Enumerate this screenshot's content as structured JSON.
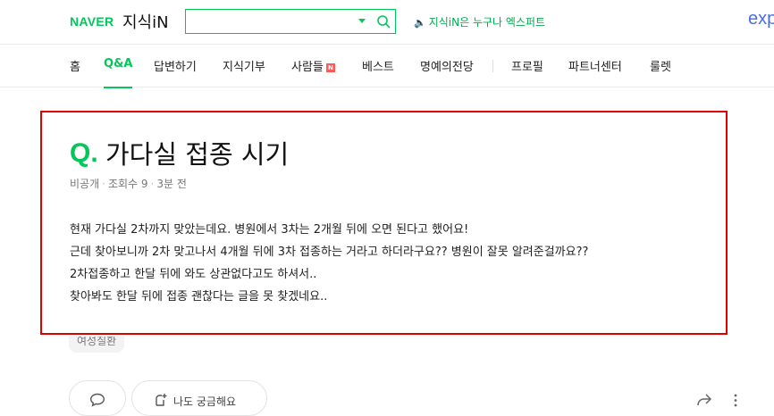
{
  "header": {
    "brand": "NAVER",
    "service": "지식iN",
    "search": {
      "value": "",
      "placeholder": ""
    },
    "notice": "지식iN은 누구나 엑스퍼트",
    "partial_logo": "exp"
  },
  "nav": {
    "items": [
      {
        "label": "홈"
      },
      {
        "label": "Q&A",
        "active": true
      },
      {
        "label": "답변하기"
      },
      {
        "label": "지식기부"
      },
      {
        "label": "사람들",
        "badge": "N"
      },
      {
        "label": "베스트"
      },
      {
        "label": "명예의전당"
      },
      {
        "label": "프로필"
      },
      {
        "label": "파트너센터"
      },
      {
        "label": "룰렛"
      }
    ]
  },
  "question": {
    "mark": "Q.",
    "title": "가다실 접종 시기",
    "meta": {
      "author": "비공개",
      "views": "조회수 9",
      "time": "3분 전"
    },
    "body": [
      "현재 가다실 2차까지 맞았는데요. 병원에서 3차는 2개월 뒤에 오면 된다고 했어요!",
      "근데 찾아보니까 2차 맞고나서 4개월 뒤에 3차 접종하는 거라고 하더라구요?? 병원이 잘못 알려준걸까요??",
      "2차접종하고 한달 뒤에 와도 상관없다고도 하셔서..",
      "찾아봐도 한달 뒤에 접종 괜찮다는 글을 못 찾겠네요.."
    ],
    "tag": "여성질환"
  },
  "actions": {
    "curious_label": "나도 궁금해요"
  },
  "colors": {
    "accent": "#03c75a",
    "highlight_border": "#e00000"
  }
}
